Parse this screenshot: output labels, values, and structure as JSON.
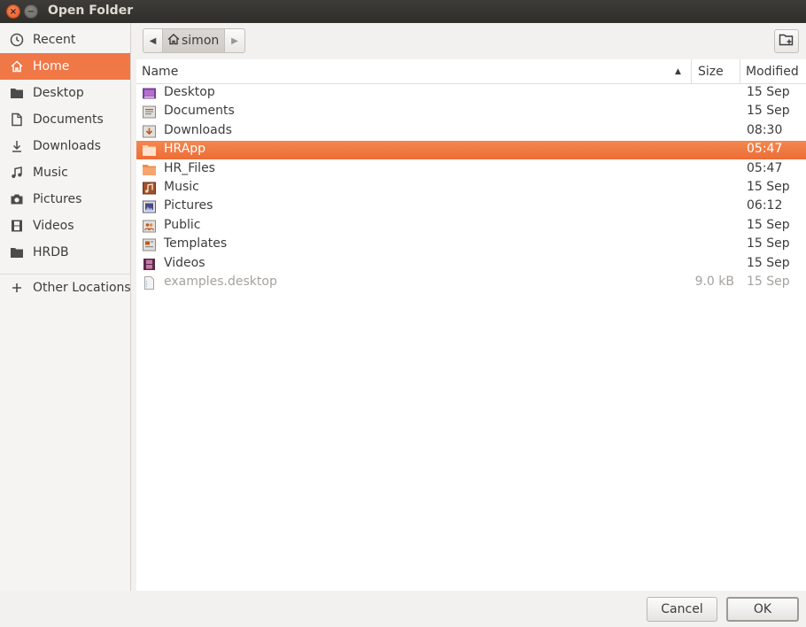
{
  "window": {
    "title": "Open Folder"
  },
  "sidebar": {
    "items": [
      {
        "label": "Recent",
        "icon": "clock-icon"
      },
      {
        "label": "Home",
        "icon": "home-icon",
        "active": true
      },
      {
        "label": "Desktop",
        "icon": "folder-icon"
      },
      {
        "label": "Documents",
        "icon": "document-icon"
      },
      {
        "label": "Downloads",
        "icon": "download-icon"
      },
      {
        "label": "Music",
        "icon": "music-icon"
      },
      {
        "label": "Pictures",
        "icon": "camera-icon"
      },
      {
        "label": "Videos",
        "icon": "film-icon"
      },
      {
        "label": "HRDB",
        "icon": "folder-icon"
      }
    ],
    "other_locations": {
      "label": "Other Locations",
      "icon": "plus-icon"
    }
  },
  "pathbar": {
    "current": "simon"
  },
  "table": {
    "headers": {
      "name": "Name",
      "size": "Size",
      "modified": "Modified"
    },
    "rows": [
      {
        "name": "Desktop",
        "size": "",
        "modified": "15 Sep",
        "kind": "desktop"
      },
      {
        "name": "Documents",
        "size": "",
        "modified": "15 Sep",
        "kind": "documents"
      },
      {
        "name": "Downloads",
        "size": "",
        "modified": "08:30",
        "kind": "downloads"
      },
      {
        "name": "HRApp",
        "size": "",
        "modified": "05:47",
        "kind": "folder",
        "selected": true
      },
      {
        "name": "HR_Files",
        "size": "",
        "modified": "05:47",
        "kind": "folder"
      },
      {
        "name": "Music",
        "size": "",
        "modified": "15 Sep",
        "kind": "music"
      },
      {
        "name": "Pictures",
        "size": "",
        "modified": "06:12",
        "kind": "pictures"
      },
      {
        "name": "Public",
        "size": "",
        "modified": "15 Sep",
        "kind": "public"
      },
      {
        "name": "Templates",
        "size": "",
        "modified": "15 Sep",
        "kind": "templates"
      },
      {
        "name": "Videos",
        "size": "",
        "modified": "15 Sep",
        "kind": "videos"
      },
      {
        "name": "examples.desktop",
        "size": "9.0 kB",
        "modified": "15 Sep",
        "kind": "file",
        "dim": true
      }
    ]
  },
  "buttons": {
    "cancel": "Cancel",
    "ok": "OK"
  },
  "colors": {
    "accent": "#f07746",
    "titlebar": "#3d3c38"
  }
}
